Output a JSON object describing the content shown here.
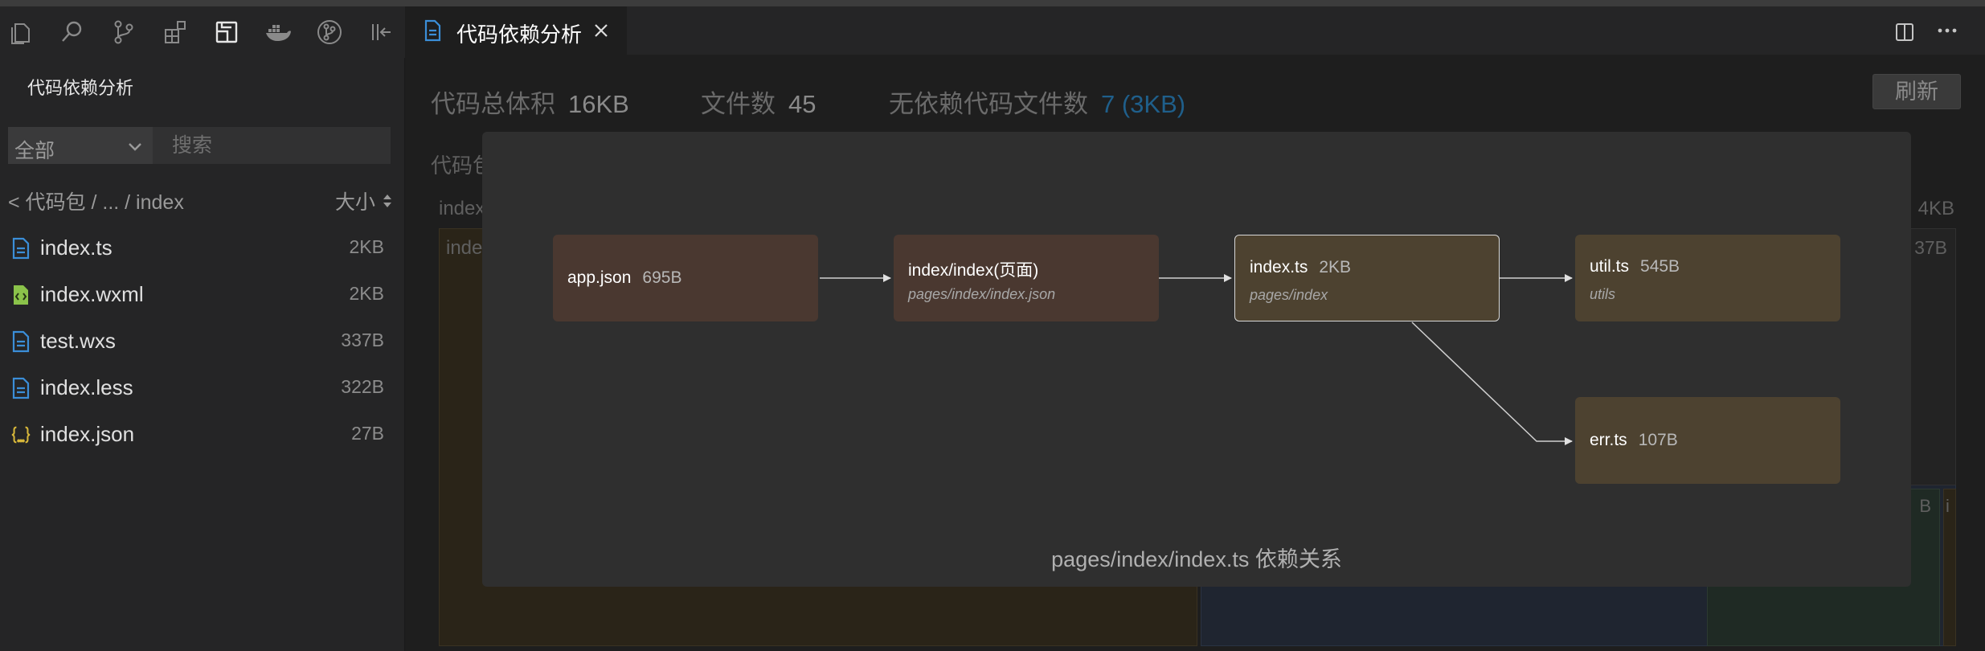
{
  "sidebar": {
    "title": "代码依赖分析",
    "filter": {
      "selected": "全部"
    },
    "search": {
      "placeholder": "搜索"
    },
    "breadcrumb": "< 代码包 / ... / index",
    "sort_label": "大小",
    "files": [
      {
        "name": "index.ts",
        "size": "2KB",
        "icon": "typescript-file-icon"
      },
      {
        "name": "index.wxml",
        "size": "2KB",
        "icon": "wxml-file-icon"
      },
      {
        "name": "test.wxs",
        "size": "337B",
        "icon": "wxs-file-icon"
      },
      {
        "name": "index.less",
        "size": "322B",
        "icon": "less-file-icon"
      },
      {
        "name": "index.json",
        "size": "27B",
        "icon": "json-file-icon"
      }
    ]
  },
  "editor": {
    "tab_label": "代码依赖分析",
    "stats": {
      "total_label": "代码总体积",
      "total_value": "16KB",
      "files_label": "文件数",
      "files_value": "45",
      "nodep_label": "无依赖代码文件数",
      "nodep_value": "7 (3KB)"
    },
    "refresh_label": "刷新",
    "pkg_label": "代码包",
    "treemap": {
      "header_left": "index",
      "header_right": "4KB",
      "cell_left": "index",
      "cell_right": "37B",
      "cell_small_1": "B",
      "cell_small_2": "i"
    }
  },
  "graph": {
    "caption": "pages/index/index.ts 依赖关系",
    "nodes": [
      {
        "name": "app.json",
        "size": "695B",
        "path": ""
      },
      {
        "name": "index/index(页面)",
        "size": "",
        "path": "pages/index/index.json"
      },
      {
        "name": "index.ts",
        "size": "2KB",
        "path": "pages/index"
      },
      {
        "name": "util.ts",
        "size": "545B",
        "path": "utils"
      },
      {
        "name": "err.ts",
        "size": "107B",
        "path": ""
      }
    ]
  },
  "colors": {
    "page_node": "#4a3830",
    "module_node": "#4d4230",
    "modal_bg": "#2f2f2f",
    "accent_blue": "#3b8ed8",
    "json_yellow": "#d7b73a",
    "wxml_green": "#8bc34a"
  }
}
